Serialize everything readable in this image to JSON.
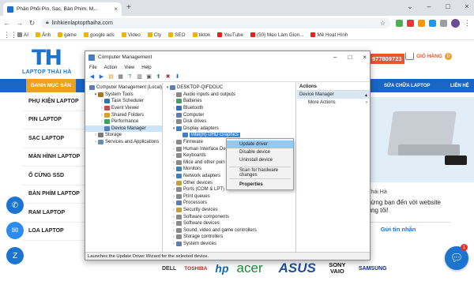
{
  "browser": {
    "tab_title": "Phân Phối Pin, Sạc, Bàn Phím, M...",
    "url": "linhkienlaptopthaiha.com",
    "bookmarks": [
      {
        "label": "AI",
        "color": "#888888"
      },
      {
        "label": "Ảnh",
        "color": "#f0b400"
      },
      {
        "label": "game",
        "color": "#f0b400"
      },
      {
        "label": "google ads",
        "color": "#f0b400"
      },
      {
        "label": "Video",
        "color": "#f0b400"
      },
      {
        "label": "Cty",
        "color": "#f0b400"
      },
      {
        "label": "SEO",
        "color": "#f0b400"
      },
      {
        "label": "tiktok",
        "color": "#f0b400"
      },
      {
        "label": "YouTube",
        "color": "#e62117"
      },
      {
        "label": "(50) Mẹo Làm Giọn...",
        "color": "#e62117"
      },
      {
        "label": "Mê Hoạt Hình",
        "color": "#e62117"
      }
    ]
  },
  "site": {
    "logo_text": "LAPTOP THÁI HÀ",
    "hotline": "977809723",
    "cart_label": "GIỎ HÀNG",
    "cart_count": "0",
    "nav_category": "DANH MỤC SẢN",
    "nav_repair": "SỬA CHỮA LAPTOP",
    "nav_contact": "LIÊN HỆ",
    "categories": [
      "PHỤ KIỆN LAPTOP",
      "PIN LAPTOP",
      "SẠC LAPTOP",
      "MÀN HÌNH LAPTOP",
      "Ổ CỨNG SSD",
      "BÀN PHÍM LAPTOP",
      "RAM LAPTOP",
      "LOA LAPTOP"
    ],
    "chat_name": "Laptop Thái Hà",
    "chat_message": "Chào mừng bạn đến với website của chúng tôi!",
    "chat_button": "Gửi tin nhắn",
    "chat_badge": "1",
    "brands": [
      {
        "label": "DELL",
        "color": "#333333"
      },
      {
        "label": "TOSHIBA",
        "color": "#d0201a"
      },
      {
        "label": "hp",
        "color": "#0f6bb5"
      },
      {
        "label": "acer",
        "color": "#1b8a3a"
      },
      {
        "label": "",
        "color": "#555555"
      },
      {
        "label": "ASUS",
        "color": "#1f4fa0"
      },
      {
        "label": "SONY VAIO",
        "color": "#111111"
      },
      {
        "label": "SAMSUNG",
        "color": "#1428a0"
      }
    ]
  },
  "computer_management": {
    "title": "Computer Management",
    "menu": [
      "File",
      "Action",
      "View",
      "Help"
    ],
    "left_tree": [
      {
        "label": "Computer Management (Local)",
        "indent": 0,
        "caret": "",
        "icon": "#5a7fb8"
      },
      {
        "label": "System Tools",
        "indent": 1,
        "caret": "▾",
        "icon": "#a6752e"
      },
      {
        "label": "Task Scheduler",
        "indent": 2,
        "caret": "›",
        "icon": "#3f6fa8"
      },
      {
        "label": "Event Viewer",
        "indent": 2,
        "caret": "›",
        "icon": "#c05050"
      },
      {
        "label": "Shared Folders",
        "indent": 2,
        "caret": "›",
        "icon": "#d8a030"
      },
      {
        "label": "Performance",
        "indent": 2,
        "caret": "›",
        "icon": "#40a060"
      },
      {
        "label": "Device Manager",
        "indent": 2,
        "caret": "",
        "icon": "#5a7fb8",
        "selected": true
      },
      {
        "label": "Storage",
        "indent": 1,
        "caret": "›",
        "icon": "#7a7a7a"
      },
      {
        "label": "Services and Applications",
        "indent": 1,
        "caret": "›",
        "icon": "#6a8ab0"
      }
    ],
    "device_tree": [
      {
        "label": "DESKTOP-QIFDOUC",
        "indent": 0,
        "caret": "▾",
        "icon": "#5a7fb8"
      },
      {
        "label": "Audio inputs and outputs",
        "indent": 1,
        "caret": "›",
        "icon": "#8a8a8a"
      },
      {
        "label": "Batteries",
        "indent": 1,
        "caret": "›",
        "icon": "#40a060"
      },
      {
        "label": "Bluetooth",
        "indent": 1,
        "caret": "›",
        "icon": "#2a6fd0"
      },
      {
        "label": "Computer",
        "indent": 1,
        "caret": "›",
        "icon": "#5a7fb8"
      },
      {
        "label": "Disk drives",
        "indent": 1,
        "caret": "›",
        "icon": "#8a8a8a"
      },
      {
        "label": "Display adapters",
        "indent": 1,
        "caret": "▾",
        "icon": "#3b7fc4"
      },
      {
        "label": "Intel(R) UHD Graphics",
        "indent": 2,
        "caret": "",
        "icon": "#3b7fc4",
        "highlight": true
      },
      {
        "label": "Firmware",
        "indent": 1,
        "caret": "›",
        "icon": "#8a8a8a"
      },
      {
        "label": "Human Interface De",
        "indent": 1,
        "caret": "›",
        "icon": "#8a8a8a"
      },
      {
        "label": "Keyboards",
        "indent": 1,
        "caret": "›",
        "icon": "#8a8a8a"
      },
      {
        "label": "Mice and other poin",
        "indent": 1,
        "caret": "›",
        "icon": "#8a8a8a"
      },
      {
        "label": "Monitors",
        "indent": 1,
        "caret": "›",
        "icon": "#3b7fc4"
      },
      {
        "label": "Network adapters",
        "indent": 1,
        "caret": "›",
        "icon": "#3b7fc4"
      },
      {
        "label": "Other devices",
        "indent": 1,
        "caret": "›",
        "icon": "#c8a030"
      },
      {
        "label": "Ports (COM & LPT)",
        "indent": 1,
        "caret": "›",
        "icon": "#8a8a8a"
      },
      {
        "label": "Print queues",
        "indent": 1,
        "caret": "›",
        "icon": "#8a8a8a"
      },
      {
        "label": "Processors",
        "indent": 1,
        "caret": "›",
        "icon": "#5a7fb8"
      },
      {
        "label": "Security devices",
        "indent": 1,
        "caret": "›",
        "icon": "#c8a030"
      },
      {
        "label": "Software components",
        "indent": 1,
        "caret": "›",
        "icon": "#8a8a8a"
      },
      {
        "label": "Software devices",
        "indent": 1,
        "caret": "›",
        "icon": "#8a8a8a"
      },
      {
        "label": "Sound, video and game controllers",
        "indent": 1,
        "caret": "›",
        "icon": "#8a8a8a"
      },
      {
        "label": "Storage controllers",
        "indent": 1,
        "caret": "›",
        "icon": "#8a8a8a"
      },
      {
        "label": "System devices",
        "indent": 1,
        "caret": "›",
        "icon": "#5a7fb8"
      }
    ],
    "actions_header": "Actions",
    "actions_sub": "Device Manager",
    "actions_more": "More Actions",
    "status": "Launches the Update Driver Wizard for the selected device."
  },
  "context_menu": {
    "items": [
      {
        "label": "Update driver",
        "active": true
      },
      {
        "label": "Disable device"
      },
      {
        "label": "Uninstall device"
      },
      {
        "sep": true
      },
      {
        "label": "Scan for hardware changes"
      },
      {
        "sep": true
      },
      {
        "label": "Properties",
        "bold": true
      }
    ]
  }
}
